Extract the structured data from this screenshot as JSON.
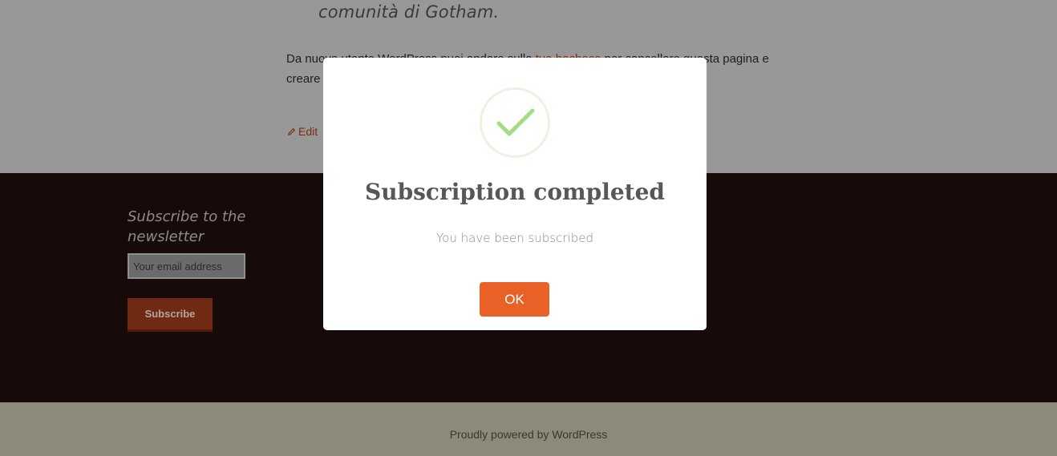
{
  "page": {
    "quote_line": "comunità di Gotham.",
    "paragraph": {
      "before_link": "Da nuovo utente WordPress puoi andare sulla ",
      "link": "tua bacheca",
      "after_link": " per cancellare questa pagina e creare"
    },
    "edit_label": "Edit"
  },
  "footer": {
    "widget_title": "Subscribe to the newsletter",
    "email_placeholder": "Your email address",
    "subscribe_label": "Subscribe",
    "powered_by": "Proudly powered by WordPress"
  },
  "modal": {
    "title": "Subscription completed",
    "message": "You have been subscribed",
    "ok_label": "OK",
    "icon": "check-icon"
  },
  "colors": {
    "accent": "#ea6128",
    "success": "#a5dc86",
    "footer_dark": "#170b0a",
    "footer_light": "#8d8a7a"
  }
}
